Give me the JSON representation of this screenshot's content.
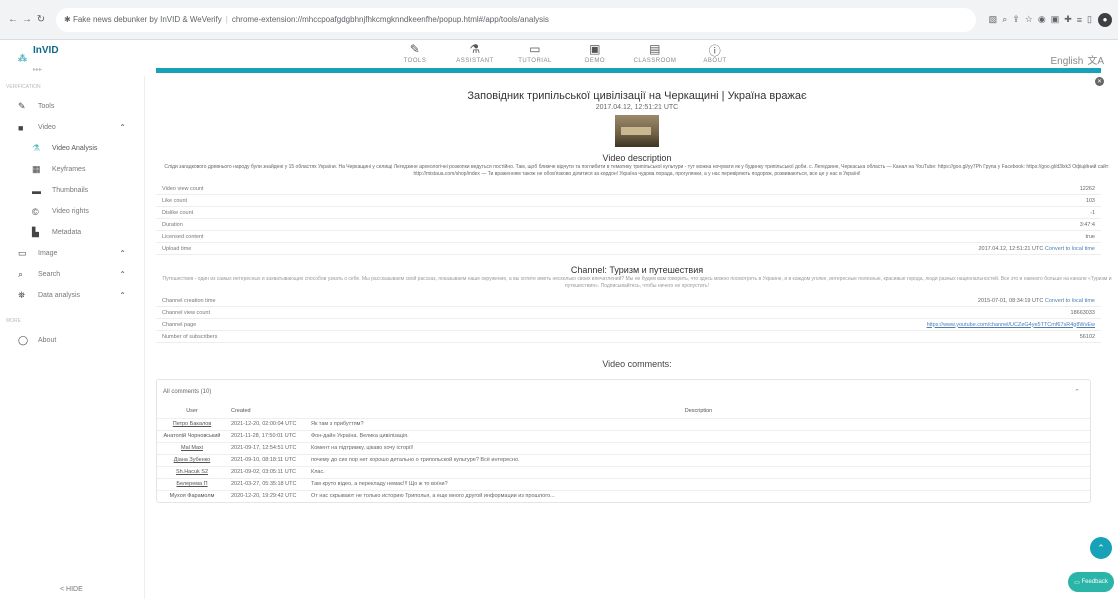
{
  "browser": {
    "ext_name": "Fake news debunker by InVID & WeVerify",
    "url": "chrome-extension://mhccpoafgdgbhnjfhkcmgknndkeenfhe/popup.html#/app/tools/analysis"
  },
  "app": {
    "logo": "InVID",
    "lang": "English"
  },
  "topnav": [
    {
      "label": "TOOLS",
      "icon": "✎"
    },
    {
      "label": "ASSISTANT",
      "icon": "⚗"
    },
    {
      "label": "TUTORIAL",
      "icon": "▭"
    },
    {
      "label": "DEMO",
      "icon": "▣"
    },
    {
      "label": "CLASSROOM",
      "icon": "▤"
    },
    {
      "label": "ABOUT",
      "icon": "ⓘ"
    }
  ],
  "sidebar": {
    "head1": "Verification",
    "head2": "More",
    "items": [
      {
        "label": "Tools",
        "icon": "✎"
      },
      {
        "label": "Video",
        "icon": "■"
      },
      {
        "label": "Video Analysis",
        "icon": "⚗"
      },
      {
        "label": "Keyframes",
        "icon": "▦"
      },
      {
        "label": "Thumbnails",
        "icon": "▬"
      },
      {
        "label": "Video rights",
        "icon": "©"
      },
      {
        "label": "Metadata",
        "icon": "▙"
      },
      {
        "label": "Image",
        "icon": "▭"
      },
      {
        "label": "Search",
        "icon": "⌕"
      },
      {
        "label": "Data analysis",
        "icon": "⛯"
      },
      {
        "label": "About",
        "icon": "◯"
      }
    ],
    "hide": "< HIDE"
  },
  "video": {
    "title": "Заповідник трипільської цивілізації на Черкащині | Україна вражає",
    "date": "2017.04.12, 12:51:21 UTC",
    "desc_title": "Video description",
    "desc": "Сліди загадкового древнього народу були знайдені у 15 областях України. На Черкащині у селищі Легедзине археологічні розкопки ведуться постійно. Там, щоб ближче відчути та поглибити в тематику трипільської культури - тут можна ночувати як у будинку трипільської доби. с. Легедзине, Черкаська область — Канал на YouTube: https://goo.gl/yy7Ph Група у Facebook: https://goo.gl/d3lxk3 Офіційний сайт: http://mistaua.com/shop/index — Ти враженням також не обов'язково ділитися за кордон! Україна чудова порада, прогулянки, а у нас перевіряють подорож, розвиваються, все це у нас в Україні!",
    "rows": [
      {
        "k": "Video view count",
        "v": "12262"
      },
      {
        "k": "Like count",
        "v": "103"
      },
      {
        "k": "Dislike count",
        "v": "-1"
      },
      {
        "k": "Duration",
        "v": "3:47:4"
      },
      {
        "k": "Licensed content",
        "v": "true"
      },
      {
        "k": "Upload time",
        "v": "2017.04.12, 12:51:21 UTC",
        "extra": "Convert to local time"
      }
    ]
  },
  "channel": {
    "title": "Channel: Туризм и путешествия",
    "desc": "Путешествия - один из самых интересных и захватывающих способов узнать о себе. Мы рассказываем свой рассказ, показываем наше окружение, а вы хотите иметь несколько своих впечатлений? Мы не будем вам говорить, что здесь можно посмотреть в Украине, и в каждом уголке, интересные полезные, красивые города, люди разных национальностей. Все это и намного больше на канале «Туризм и путешествия». Подписывайтесь, чтобы ничего не пропустить!",
    "rows": [
      {
        "k": "Channel creation time",
        "v": "2015-07-01, 08:34:19 UTC",
        "extra": "Convert to local time"
      },
      {
        "k": "Channel view count",
        "v": "18663033"
      },
      {
        "k": "Channel page",
        "v": "https://www.youtube.com/channel/UCZeG4ye5TTCmf67sR4g8WvEw",
        "link": true
      },
      {
        "k": "Number of subscribers",
        "v": "56102"
      }
    ]
  },
  "comments": {
    "title": "Video comments:",
    "all_label": "All comments (10)",
    "headers": [
      "User",
      "Created",
      "Description"
    ],
    "rows": [
      {
        "user": "Петро Бакалов",
        "date": "2021-12-20, 02:00:04 UTC",
        "text": "Як там з прибуттям?"
      },
      {
        "user": "Анатолій Чорновський",
        "date": "2021-11-28, 17:50:01 UTC",
        "text": "Фон-дайн Україна. Велика цивілізація."
      },
      {
        "user": "Mal Maxi",
        "date": "2021-09-17, 12:54:51 UTC",
        "text": "Комент на підтримку, цікаво хочу історії!"
      },
      {
        "user": "Діана Зубенко",
        "date": "2021-09-10, 08:18:11 UTC",
        "text": "почему до сих пор нет хорошо детально о трипольской культуре? Всё интересно."
      },
      {
        "user": "Sh.Hacuk S2",
        "date": "2021-09-02, 03:05:11 UTC",
        "text": "Клас."
      },
      {
        "user": "Белерема П",
        "date": "2021-03-27, 05:35:18 UTC",
        "text": "Там круто відео, а перекладу немає!!! Що ж то воїни?"
      },
      {
        "user": "Мухоя Фарамолм",
        "date": "2020-12-20, 19:29:42 UTC",
        "text": "От нас скрывают не только историю Триполья, а еще много другой информации из прошлого..."
      }
    ]
  },
  "feedback": "Feedback"
}
